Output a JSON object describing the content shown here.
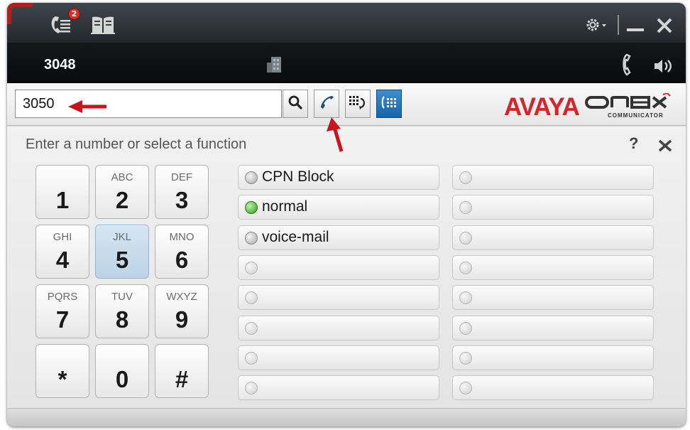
{
  "header": {
    "notification_count": "2",
    "extension": "3048"
  },
  "search": {
    "value": "3050"
  },
  "logo": {
    "brand": "AVAYA",
    "product_sub": "COMMUNICATOR"
  },
  "dialpad": {
    "prompt": "Enter a number or select a function",
    "help_label": "?",
    "keys": [
      {
        "digit": "1",
        "letters": ""
      },
      {
        "digit": "2",
        "letters": "ABC"
      },
      {
        "digit": "3",
        "letters": "DEF"
      },
      {
        "digit": "4",
        "letters": "GHI"
      },
      {
        "digit": "5",
        "letters": "JKL"
      },
      {
        "digit": "6",
        "letters": "MNO"
      },
      {
        "digit": "7",
        "letters": "PQRS"
      },
      {
        "digit": "8",
        "letters": "TUV"
      },
      {
        "digit": "9",
        "letters": "WXYZ"
      },
      {
        "digit": "*",
        "letters": ""
      },
      {
        "digit": "0",
        "letters": ""
      },
      {
        "digit": "#",
        "letters": ""
      }
    ],
    "selected_key": "5"
  },
  "features": [
    {
      "label": "CPN Block",
      "status": "off"
    },
    {
      "label": "normal",
      "status": "on"
    },
    {
      "label": "voice-mail",
      "status": "off"
    }
  ],
  "colors": {
    "brand_red": "#d4252b",
    "led_on": "#2d9c1e",
    "active_blue": "#1565a8",
    "arrow_red": "#c8141b"
  },
  "icons": {
    "titlebar": [
      "call-log-icon",
      "contacts-book-icon",
      "settings-gear-icon",
      "minimize-icon",
      "close-icon"
    ],
    "status": [
      "building-icon",
      "handset-icon",
      "speaker-icon"
    ],
    "search_row": [
      "search-icon",
      "call-icon",
      "dialpad-redial-icon",
      "dialpad-icon"
    ]
  }
}
